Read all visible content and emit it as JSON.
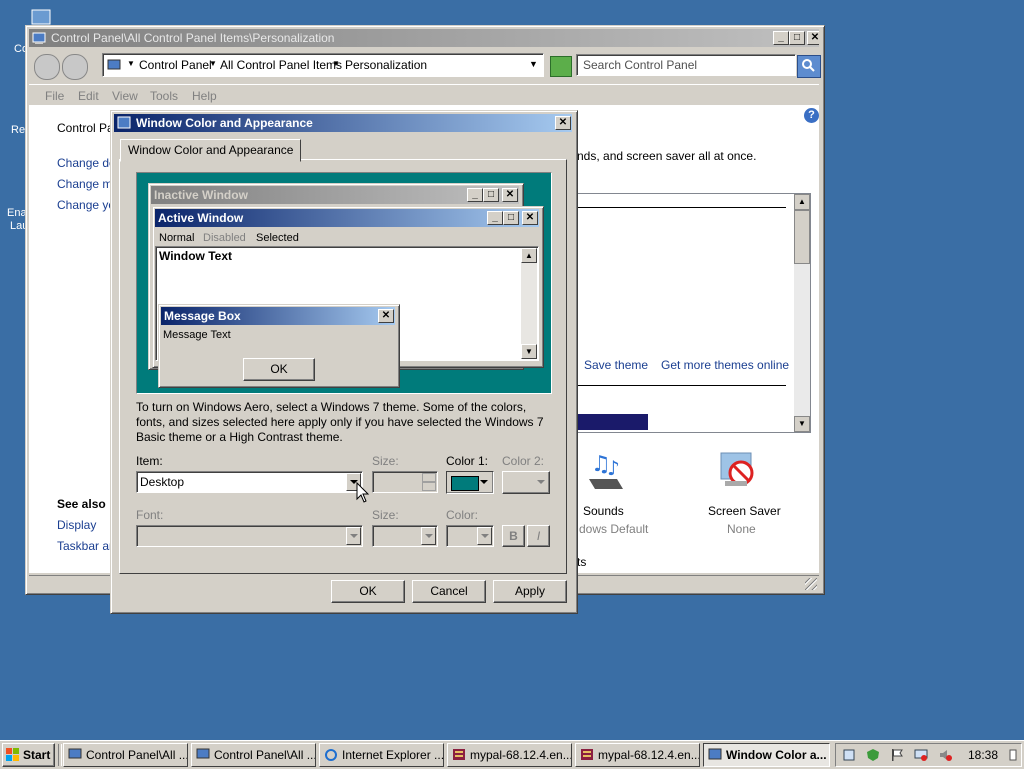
{
  "desktop": {
    "icon_labels": [
      "Co",
      "Re",
      "Ena",
      "Lau"
    ]
  },
  "control_panel": {
    "title": "Control Panel\\All Control Panel Items\\Personalization",
    "breadcrumb": [
      "Control Panel",
      "All Control Panel Items",
      "Personalization"
    ],
    "search_placeholder": "Search Control Panel",
    "menu": [
      "File",
      "Edit",
      "View",
      "Tools",
      "Help"
    ],
    "left_links": [
      "Control Pane",
      "Change des",
      "Change mo",
      "Change you"
    ],
    "see_also_heading": "See also",
    "see_also_links": [
      "Display",
      "Taskbar an"
    ],
    "intro_text": "nds, and screen saver all at once.",
    "theme_links": [
      "Save theme",
      "Get more themes online"
    ],
    "bottom_items": [
      {
        "label": "Sounds",
        "sub": "dows Default"
      },
      {
        "label": "Screen Saver",
        "sub": "None"
      }
    ],
    "partial_text": "ts"
  },
  "dialog": {
    "title": "Window Color and Appearance",
    "tab": "Window Color and Appearance",
    "preview": {
      "inactive_title": "Inactive Window",
      "active_title": "Active Window",
      "menu": [
        "Normal",
        "Disabled",
        "Selected"
      ],
      "window_text": "Window Text",
      "msgbox_title": "Message Box",
      "msgbox_text": "Message Text",
      "msgbox_ok": "OK"
    },
    "info_text": "To turn on Windows Aero, select a Windows 7 theme.  Some of the colors, fonts, and sizes selected here apply only if you have selected the Windows 7 Basic theme or a High Contrast theme.",
    "item_label": "Item:",
    "item_value": "Desktop",
    "size_label": "Size:",
    "color1_label": "Color 1:",
    "color2_label": "Color 2:",
    "color1_value": "#007b7b",
    "font_label": "Font:",
    "font_size_label": "Size:",
    "font_color_label": "Color:",
    "bold_label": "B",
    "italic_label": "I",
    "ok": "OK",
    "cancel": "Cancel",
    "apply": "Apply"
  },
  "taskbar": {
    "start": "Start",
    "items": [
      "Control Panel\\All ...",
      "Control Panel\\All ...",
      "Internet Explorer ...",
      "mypal-68.12.4.en...",
      "mypal-68.12.4.en...",
      "Window Color a..."
    ],
    "clock": "18:38"
  },
  "colors": {
    "desktop": "#3a6ea5",
    "preview_bg": "#007b7b",
    "active_title_start": "#0a246a",
    "active_title_end": "#a6caf0",
    "link": "#1b3f91"
  }
}
